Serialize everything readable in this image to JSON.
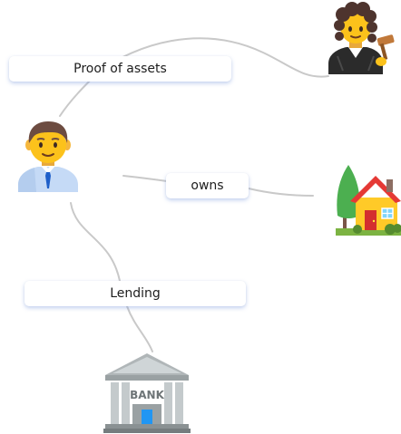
{
  "nodes": {
    "person": {
      "icon": "man-office-worker-icon"
    },
    "judge": {
      "icon": "judge-icon"
    },
    "house": {
      "icon": "house-with-garden-icon"
    },
    "bank": {
      "icon": "bank-icon",
      "sign_text": "BANK"
    }
  },
  "edges": {
    "proof_of_assets": {
      "label": "Proof of assets",
      "from": "person",
      "to": "judge"
    },
    "owns": {
      "label": "owns",
      "from": "person",
      "to": "house"
    },
    "lending": {
      "label": "Lending",
      "from": "person",
      "to": "bank"
    }
  },
  "colors": {
    "edge": "#c9c9c9",
    "label_shadow": "#7896dc",
    "text": "#1d1d1d"
  }
}
